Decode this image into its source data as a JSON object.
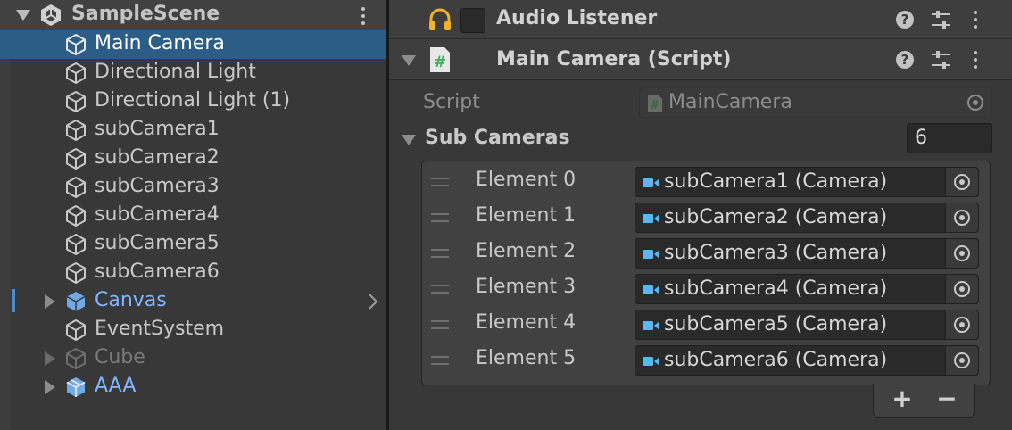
{
  "hierarchy": {
    "scene_name": "SampleScene",
    "items": [
      {
        "label": "Main Camera",
        "state": "selected"
      },
      {
        "label": "Directional Light",
        "state": "normal"
      },
      {
        "label": "Directional Light (1)",
        "state": "normal"
      },
      {
        "label": "subCamera1",
        "state": "normal"
      },
      {
        "label": "subCamera2",
        "state": "normal"
      },
      {
        "label": "subCamera3",
        "state": "normal"
      },
      {
        "label": "subCamera4",
        "state": "normal"
      },
      {
        "label": "subCamera5",
        "state": "normal"
      },
      {
        "label": "subCamera6",
        "state": "normal"
      },
      {
        "label": "Canvas",
        "state": "prefab"
      },
      {
        "label": "EventSystem",
        "state": "normal"
      },
      {
        "label": "Cube",
        "state": "inactive"
      },
      {
        "label": "AAA",
        "state": "prefab"
      }
    ]
  },
  "inspector": {
    "audio_listener": {
      "title": "Audio Listener",
      "icon": "headphones-icon",
      "enabled": false
    },
    "script_component": {
      "title": "Main Camera (Script)",
      "script_label": "Script",
      "script_value": "MainCamera",
      "sub_cameras_label": "Sub Cameras",
      "sub_cameras_size": "6",
      "elements": [
        {
          "label": "Element 0",
          "value": "subCamera1 (Camera)"
        },
        {
          "label": "Element 1",
          "value": "subCamera2 (Camera)"
        },
        {
          "label": "Element 2",
          "value": "subCamera3 (Camera)"
        },
        {
          "label": "Element 3",
          "value": "subCamera4 (Camera)"
        },
        {
          "label": "Element 4",
          "value": "subCamera5 (Camera)"
        },
        {
          "label": "Element 5",
          "value": "subCamera6 (Camera)"
        }
      ],
      "add_label": "+",
      "remove_label": "−"
    }
  },
  "colors": {
    "selection": "#2c5d87",
    "prefab_text": "#7fb6ff",
    "headphones": "#f0b429",
    "camera_icon": "#58b8f0",
    "script_icon": "#3fae5b"
  }
}
